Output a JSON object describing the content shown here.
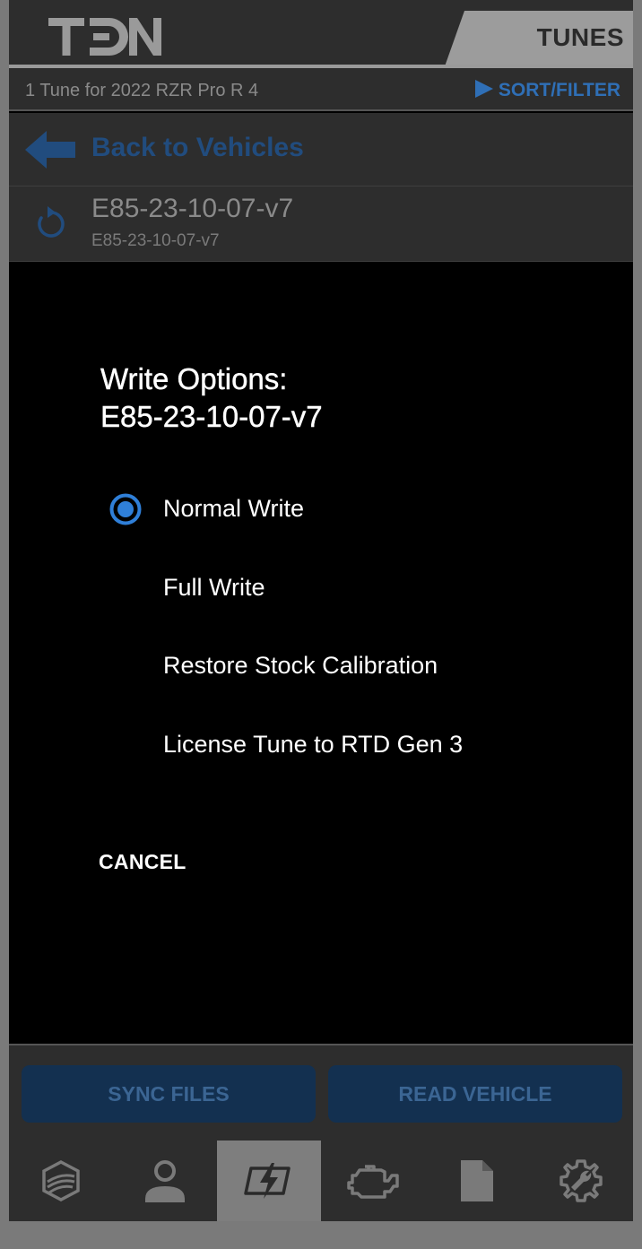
{
  "header": {
    "logo_text": "TDN",
    "tab_label": "TUNES"
  },
  "subheader": {
    "count_text": "1 Tune for 2022 RZR Pro R 4",
    "sort_filter_label": "SORT/FILTER"
  },
  "back": {
    "label": "Back to Vehicles"
  },
  "tune": {
    "name": "E85-23-10-07-v7",
    "subtitle": "E85-23-10-07-v7"
  },
  "dialog": {
    "title_line1": "Write Options:",
    "title_line2": "E85-23-10-07-v7",
    "options": [
      {
        "label": "Normal Write",
        "selected": true
      },
      {
        "label": "Full Write",
        "selected": false
      },
      {
        "label": "Restore Stock Calibration",
        "selected": false
      },
      {
        "label": "License Tune to RTD Gen 3",
        "selected": false
      }
    ],
    "cancel_label": "CANCEL"
  },
  "buttons": {
    "sync_label": "SYNC FILES",
    "read_label": "READ VEHICLE"
  },
  "nav": {
    "items": [
      {
        "icon": "layers-icon",
        "active": false
      },
      {
        "icon": "user-icon",
        "active": false
      },
      {
        "icon": "lightning-icon",
        "active": true
      },
      {
        "icon": "engine-icon",
        "active": false
      },
      {
        "icon": "document-icon",
        "active": false
      },
      {
        "icon": "settings-wrench-icon",
        "active": false
      }
    ]
  },
  "colors": {
    "accent": "#2f6fb6",
    "radio_selected": "#2f7fd8",
    "button_bg": "#133050",
    "header_bg": "#2d2d2d"
  }
}
